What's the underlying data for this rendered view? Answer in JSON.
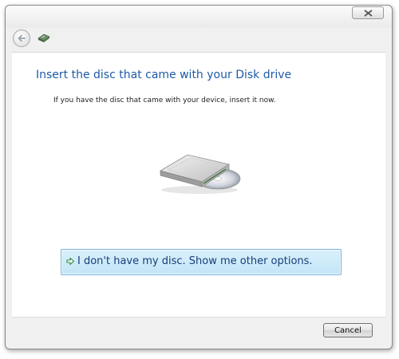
{
  "window": {
    "title": ""
  },
  "icons": {
    "close": "close-icon",
    "back": "back-arrow-icon",
    "device": "hardware-device-icon",
    "drive": "disk-drive-icon",
    "link_arrow": "arrow-right-icon"
  },
  "main": {
    "heading": "Insert the disc that came with your Disk drive",
    "instruction": "If you have the disc that came with your device, insert it now.",
    "option_link": "I don't have my disc.  Show me other options."
  },
  "footer": {
    "cancel_label": "Cancel"
  },
  "colors": {
    "heading": "#1e5aa8",
    "link_bg": "#c3e5f7",
    "link_border": "#7fb4d8",
    "link_text": "#163e7a"
  }
}
